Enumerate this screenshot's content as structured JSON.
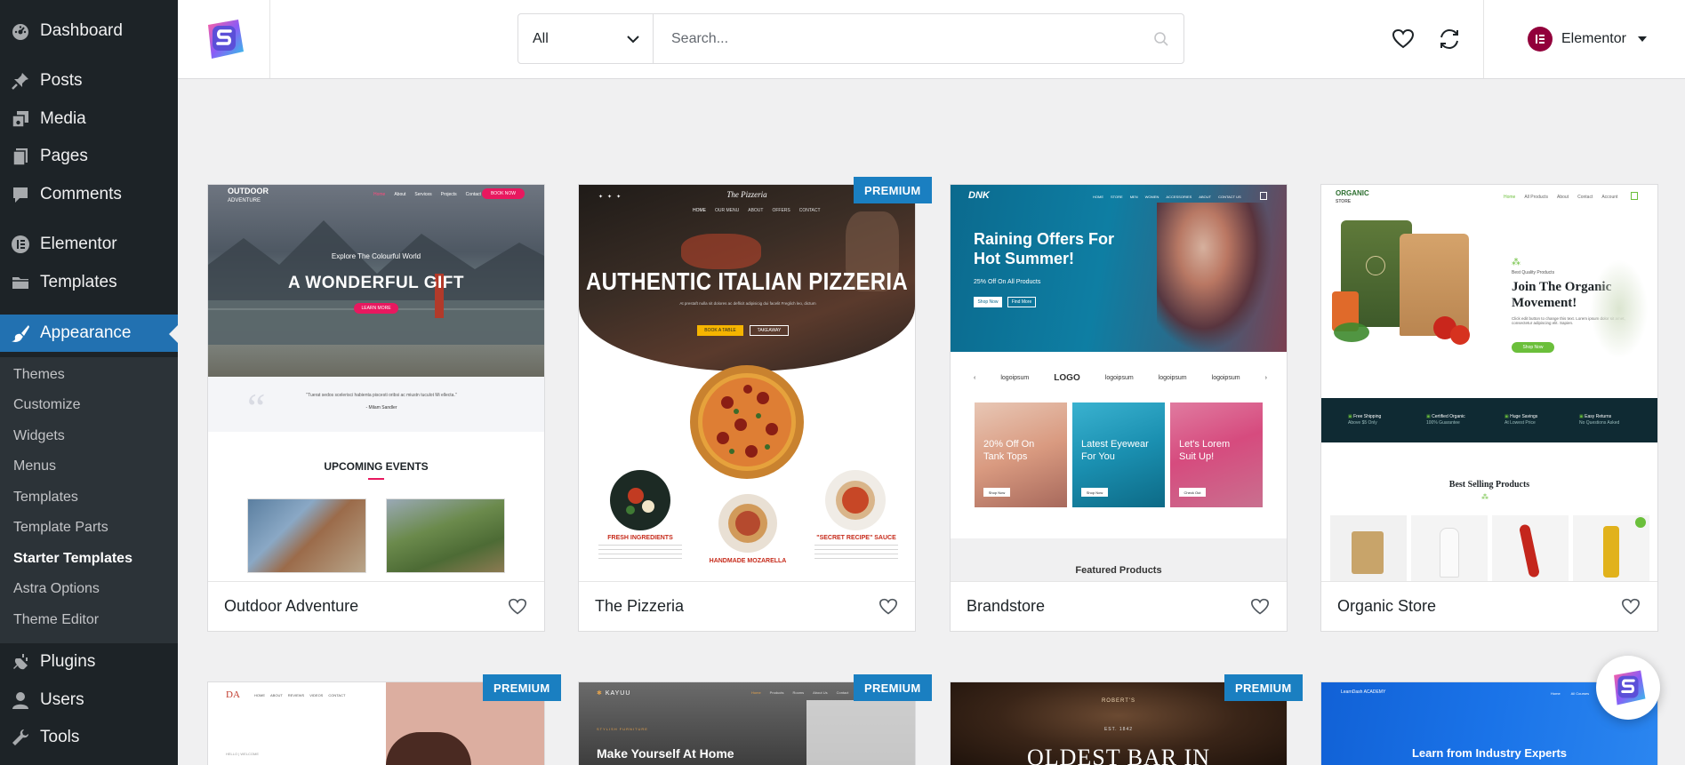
{
  "sidebar": {
    "items": [
      {
        "label": "Dashboard",
        "icon": "dashboard-icon"
      },
      {
        "label": "Posts",
        "icon": "pin-icon"
      },
      {
        "label": "Media",
        "icon": "media-icon"
      },
      {
        "label": "Pages",
        "icon": "pages-icon"
      },
      {
        "label": "Comments",
        "icon": "comments-icon"
      },
      {
        "label": "Elementor",
        "icon": "elementor-icon"
      },
      {
        "label": "Templates",
        "icon": "folder-icon"
      },
      {
        "label": "Appearance",
        "icon": "brush-icon"
      },
      {
        "label": "Plugins",
        "icon": "plugin-icon"
      },
      {
        "label": "Users",
        "icon": "user-icon"
      },
      {
        "label": "Tools",
        "icon": "wrench-icon"
      }
    ],
    "submenu": [
      "Themes",
      "Customize",
      "Widgets",
      "Menus",
      "Templates",
      "Template Parts",
      "Starter Templates",
      "Astra Options",
      "Theme Editor"
    ],
    "current_submenu": "Starter Templates"
  },
  "topbar": {
    "filter_value": "All",
    "search_placeholder": "Search...",
    "builder_label": "Elementor"
  },
  "badges": {
    "premium": "PREMIUM"
  },
  "cards": [
    {
      "title": "Outdoor Adventure",
      "premium": false
    },
    {
      "title": "The Pizzeria",
      "premium": true
    },
    {
      "title": "Brandstore",
      "premium": false
    },
    {
      "title": "Organic Store",
      "premium": false
    }
  ],
  "previews": {
    "outdoor": {
      "brand_1": "OUTDOOR",
      "brand_2": "ADVENTURE",
      "nav": [
        "Home",
        "About",
        "Services",
        "Projects",
        "Contact"
      ],
      "cta": "BOOK NOW",
      "tagline": "Explore The Colourful World",
      "headline": "A WONDERFUL GIFT",
      "button": "LEARN MORE",
      "quote": "\"Tuerat sedos scelerisci habienta piscesti oribsi ac miustn tuculot Mi ellecta.\"",
      "quote_author": "- Milam Sandler",
      "events_title": "UPCOMING EVENTS"
    },
    "pizzeria": {
      "logo": "The Pizzeria",
      "nav": [
        "HOME",
        "OUR MENU",
        "ABOUT",
        "OFFERS",
        "CONTACT"
      ],
      "headline": "AUTHENTIC ITALIAN PIZZERIA",
      "sub": "At prestaft nulla sit dolores ac deflicit adipisicig dui facelit Freglich leo, dictum",
      "btn_1": "BOOK A TABLE",
      "btn_2": "TAKEAWAY",
      "features": [
        "FRESH INGREDIENTS",
        "HANDMADE MOZARELLA",
        "\"SECRET RECIPE\" SAUCE"
      ]
    },
    "brandstore": {
      "logo": "DNK",
      "nav": [
        "HOME",
        "STORE",
        "MEN",
        "WOMEN",
        "ACCESSORIES",
        "ABOUT",
        "CONTACT US"
      ],
      "headline_1": "Raining Offers For",
      "headline_2": "Hot Summer!",
      "sub": "25% Off On All Products",
      "btn_1": "Shop Now",
      "btn_2": "Find More",
      "logos": [
        "logoipsum",
        "LOGO",
        "logoipsum",
        "logoipsum",
        "logoipsum"
      ],
      "promos": [
        {
          "l1": "20% Off On",
          "l2": "Tank Tops",
          "btn": "Shop Now"
        },
        {
          "l1": "Latest Eyewear",
          "l2": "For You",
          "btn": "Shop Now"
        },
        {
          "l1": "Let's Lorem",
          "l2": "Suit Up!",
          "btn": "Check Out"
        }
      ],
      "featured": "Featured Products"
    },
    "organic": {
      "logo_1": "ORGANIC",
      "logo_2": "STORE",
      "nav": [
        "Home",
        "All Products",
        "About",
        "Contact",
        "Account"
      ],
      "kicker": "Best Quality Products",
      "headline_1": "Join The Organic",
      "headline_2": "Movement!",
      "sub": "Click edit button to change this text. Lorem ipsum dolor sit amet, consectetur adipiscing elit. Sapien.",
      "btn": "Shop Now",
      "features": [
        {
          "t": "Free Shipping",
          "s": "Above $5 Only"
        },
        {
          "t": "Certified Organic",
          "s": "100% Guarantee"
        },
        {
          "t": "Huge Savings",
          "s": "At Lowest Price"
        },
        {
          "t": "Easy Returns",
          "s": "No Questions Asked"
        }
      ],
      "best": "Best Selling Products"
    },
    "row2": {
      "da_logo": "DA",
      "da_nav": [
        "HOME",
        "ABOUT",
        "REVIEWS",
        "VIDEOS",
        "CONTACT"
      ],
      "da_welcome": "HELLO | WELCOME",
      "kayuu_logo": "KAYUU",
      "kayuu_nav": [
        "Home",
        "Products",
        "Rooms",
        "About Us",
        "Contact"
      ],
      "kayuu_kicker": "STYLISH FURNITURE",
      "kayuu_headline": "Make Yourself At Home",
      "bar_sign": "ROBERT'S",
      "bar_est": "EST. 1842",
      "bar_headline": "OLDEST BAR IN",
      "ld_logo": "LearnDash ACADEMY",
      "ld_nav": [
        "Home",
        "All Courses",
        "Blog"
      ],
      "ld_headline": "Learn from Industry Experts"
    }
  }
}
